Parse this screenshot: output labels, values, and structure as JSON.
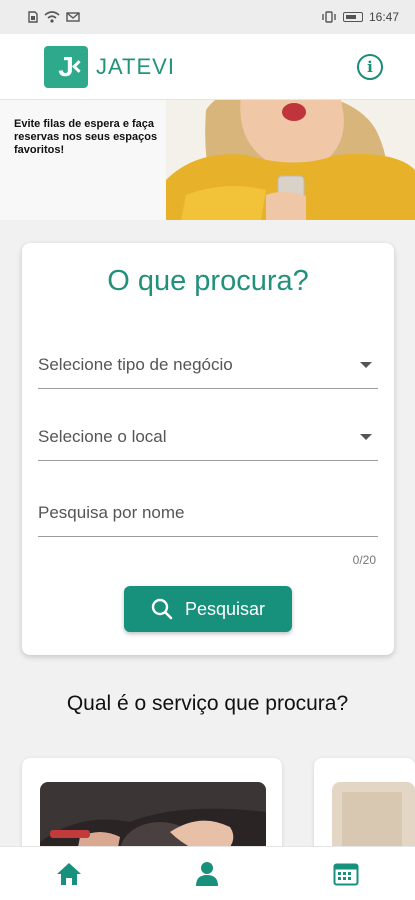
{
  "status_bar": {
    "time": "16:47"
  },
  "header": {
    "logo_letter": "J",
    "logo_text": "JATEVI"
  },
  "banner": {
    "text": "Evite filas de espera e faça reservas nos seus espaços favoritos!"
  },
  "search": {
    "title": "O que procura?",
    "business_type_placeholder": "Selecione tipo de negócio",
    "location_placeholder": "Selecione o local",
    "name_placeholder": "Pesquisa por nome",
    "counter": "0/20",
    "button_label": "Pesquisar"
  },
  "services": {
    "title": "Qual é o serviço que procura?"
  },
  "nav": {
    "items": [
      "home-icon",
      "person-icon",
      "calendar-icon"
    ],
    "accent": "#17907c"
  },
  "colors": {
    "brand": "#2ea98b",
    "brand_dark": "#17907c"
  }
}
